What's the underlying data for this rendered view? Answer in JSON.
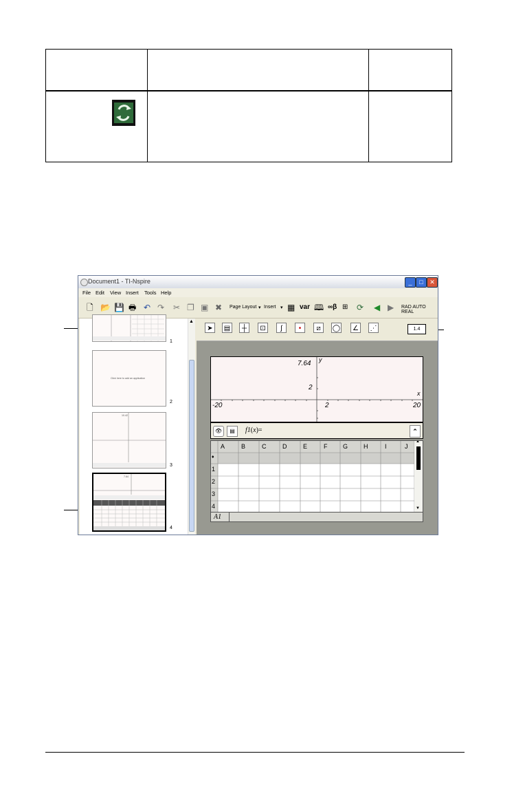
{
  "window": {
    "title": "Document1 - TI-Nspire",
    "menu": [
      "File",
      "Edit",
      "View",
      "Insert",
      "Tools",
      "Help"
    ],
    "toolbar": {
      "page_layout": "Page Layout",
      "insert": "Insert",
      "var": "var",
      "status": "RAD AUTO REAL"
    }
  },
  "left_pane": {
    "pages": [
      {
        "number": "1"
      },
      {
        "number": "2",
        "text": "Click here to add an application"
      },
      {
        "number": "3",
        "ymax": "10.42"
      },
      {
        "number": "4",
        "ymax": "7.64"
      }
    ]
  },
  "right_pane": {
    "page_label": "1.4",
    "graph": {
      "y_max": "7.64",
      "y_tick": "2",
      "x_min": "-20",
      "x_tick": "2",
      "x_max": "20",
      "x_axis": "x",
      "y_axis": "y"
    },
    "entry_line": {
      "fn": "f1",
      "var": "x",
      "paren_open": "(",
      "paren_close": ")",
      "equals": "="
    },
    "spreadsheet": {
      "columns": [
        "A",
        "B",
        "C",
        "D",
        "E",
        "F",
        "G",
        "H",
        "I",
        "J"
      ],
      "formula_row": "♦",
      "rows": [
        "1",
        "2",
        "3",
        "4"
      ],
      "cell_ref": "A1"
    }
  },
  "colors": {
    "graph_bg": "#fbf3f3",
    "pane_gray": "#989991",
    "window_face": "#ece9d8",
    "title_blue": "#3a6fd8",
    "close_red": "#d8563a"
  }
}
